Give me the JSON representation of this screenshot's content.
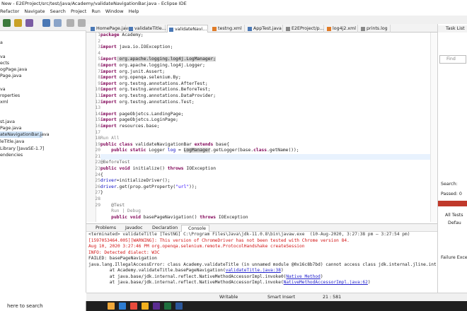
{
  "window": {
    "title": "New - E2EProject/src/test/java/Academy/validateNavigationBar.java - Eclipse IDE"
  },
  "menu": [
    "Refactor",
    "Navigate",
    "Search",
    "Project",
    "Run",
    "Window",
    "Help"
  ],
  "left_tree": [
    "a",
    "va",
    "ects",
    "ogPage.java",
    "Page.java",
    "va",
    "roperties",
    "xml",
    "st.java",
    "Page.java",
    "ateNavigationBar.java",
    "leTitle.java",
    "Library [JavaSE-1.7]",
    "endencies"
  ],
  "editor_tabs": [
    {
      "label": "HomePage.java"
    },
    {
      "label": "validateTitle..."
    },
    {
      "label": "validateNavi..."
    },
    {
      "label": "testng.xml"
    },
    {
      "label": "AppTest.java"
    },
    {
      "label": "E2EProject/p..."
    },
    {
      "label": "log4j2.xml"
    },
    {
      "label": "prints.log"
    }
  ],
  "line_numbers": [
    "1",
    "2",
    "3",
    "4",
    "5",
    "6",
    "7",
    "8",
    "9",
    "10",
    "11",
    "12",
    "13",
    "14",
    "15",
    "16",
    "17",
    "18",
    "19",
    "20",
    "21",
    "22",
    "23",
    "24",
    "25",
    "26",
    "27",
    "28",
    "29",
    ""
  ],
  "code": {
    "l1a": "package",
    "l1b": " Academy;",
    "l3a": "import",
    "l3b": " java.io.IOException;",
    "l5a": "import",
    "l5b": " org.apache.logging.log4j.LogManager;",
    "l6a": "import",
    "l6b": " org.apache.logging.log4j.Logger;",
    "l7a": "import",
    "l7b": " org.junit.Assert;",
    "l8a": "import",
    "l8b": " org.openqa.selenium.By;",
    "l9a": "import",
    "l9b": " org.testng.annotations.AfterTest;",
    "l10a": "import",
    "l10b": " org.testng.annotations.BeforeTest;",
    "l11a": "import",
    "l11b": " org.testng.annotations.DataProvider;",
    "l12a": "import",
    "l12b": " org.testng.annotations.Test;",
    "l14a": "import",
    "l14b": " pageObjetcs.LandingPage;",
    "l15a": "import",
    "l15b": " pageObjetcs.LoginPage;",
    "l16a": "import",
    "l16b": " resources.base;",
    "runall": "Run All",
    "l19a": "public class",
    "l19b": " validateNavigationBar ",
    "l19c": "extends",
    "l19d": " base{",
    "l20a": "    public static",
    "l20b": " Logger ",
    "l20c": "log",
    "l20d": " = ",
    "l20e": "LogManager",
    "l20f": ".getLogger(base.",
    "l20g": "class",
    "l20h": ".getName());",
    "l22a": "@BeforeTest",
    "l23a": "public void",
    "l23b": " initialize() ",
    "l23c": "throws",
    "l23d": " IOException",
    "l24a": "{",
    "l25a": "driver",
    "l25b": "=initializeDriver();",
    "l26a": "driver",
    "l26b": ".get(prop.getProperty(",
    "l26c": "\"url\"",
    "l26d": "));",
    "l27a": "}",
    "l29a": "    @Test",
    "rundebug": "    Run | Debug",
    "l30a": "    public void",
    "l30b": " basePageNavigation() ",
    "l30c": "throws",
    "l30d": " IOException"
  },
  "bottom_tabs": [
    {
      "label": "Problems"
    },
    {
      "label": "Javadoc"
    },
    {
      "label": "Declaration"
    },
    {
      "label": "Console"
    }
  ],
  "console": {
    "header": "<terminated> validateTitle [TestNG] C:\\Program Files\\Java\\jdk-11.0.8\\bin\\javaw.exe  (10-Aug-2020, 3:27:38 pm – 3:27:54 pm)",
    "l1": "[1597053464.005][WARNING]: This version of ChromeDriver has not been tested with Chrome version 84.",
    "l2": "Aug 10, 2020 3:27:46 PM org.openqa.selenium.remote.ProtocolHandshake createSession",
    "l3": "INFO: Detected dialect: W3C",
    "l4": "FAILED: basePageNavigation",
    "l5": "java.lang.IllegalAccessError: class Academy.validateTitle (in unnamed module @0x16c8b7bd) cannot access class jdk.internal.jline.int",
    "l6a": "        at Academy.validateTitle.basePageNavigation(",
    "l6b": "validateTitle.java:38",
    "l6c": ")",
    "l7a": "        at java.base/jdk.internal.reflect.NativeMethodAccessorImpl.invoke0(",
    "l7b": "Native Method",
    "l7c": ")",
    "l8a": "        at java.base/jdk.internal.reflect.NativeMethodAccessorImpl.invoke(",
    "l8b": "NativeMethodAccessorImpl.java:62",
    "l8c": ")"
  },
  "status": {
    "writable": "Writable",
    "insert": "Smart Insert",
    "position": "21 : 581"
  },
  "right_pane": {
    "task_list": "Task List",
    "find": "Find",
    "search": "Search:",
    "passed": "Passed: 0",
    "all_tests": "All Tests",
    "default": "Defau",
    "failure": "Failure Excep"
  },
  "taskbar": {
    "search_placeholder": "here to search"
  },
  "colors": {
    "keyword": "#7f0055",
    "string": "#2a00ff",
    "error": "#d21414",
    "link": "#2222cc",
    "line_highlight": "#e8f2fe"
  }
}
